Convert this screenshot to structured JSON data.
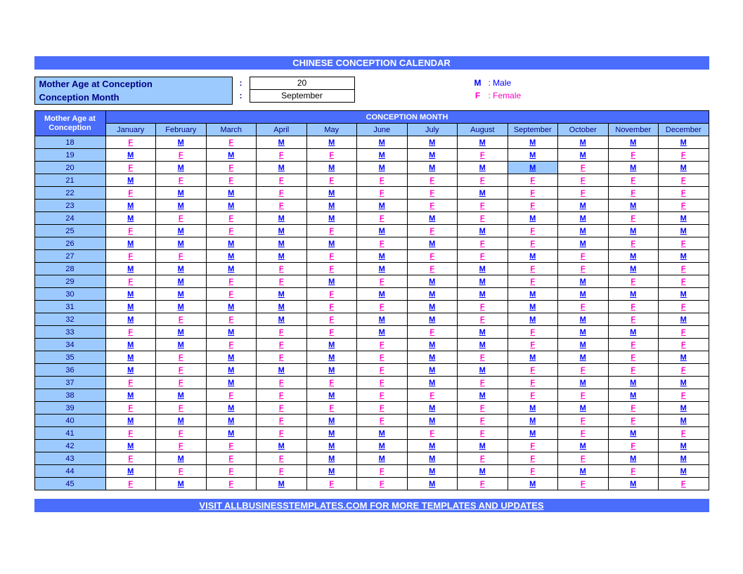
{
  "title": "CHINESE CONCEPTION CALENDAR",
  "inputs": {
    "age_label": "Mother Age at Conception",
    "age_value": "20",
    "month_label": "Conception Month",
    "month_value": "September",
    "colon": ":"
  },
  "legend": {
    "male_key": "M",
    "male_label": ": Male",
    "female_key": "F",
    "female_label": ": Female"
  },
  "table": {
    "corner_label": "Mother Age at Conception",
    "conception_month_title": "CONCEPTION MONTH",
    "months": [
      "January",
      "February",
      "March",
      "April",
      "May",
      "June",
      "July",
      "August",
      "September",
      "October",
      "November",
      "December"
    ],
    "ages": [
      18,
      19,
      20,
      21,
      22,
      23,
      24,
      25,
      26,
      27,
      28,
      29,
      30,
      31,
      32,
      33,
      34,
      35,
      36,
      37,
      38,
      39,
      40,
      41,
      42,
      43,
      44,
      45
    ],
    "highlight": {
      "age": 20,
      "month_index": 8
    }
  },
  "chart_data": {
    "type": "table",
    "title": "Chinese Conception Calendar — predicted gender by mother's age at conception vs conception month",
    "xlabel": "Conception Month",
    "ylabel": "Mother Age at Conception",
    "categories": [
      "January",
      "February",
      "March",
      "April",
      "May",
      "June",
      "July",
      "August",
      "September",
      "October",
      "November",
      "December"
    ],
    "rows": [
      {
        "age": 18,
        "values": [
          "F",
          "M",
          "F",
          "M",
          "M",
          "M",
          "M",
          "M",
          "M",
          "M",
          "M",
          "M"
        ]
      },
      {
        "age": 19,
        "values": [
          "M",
          "F",
          "M",
          "F",
          "F",
          "M",
          "M",
          "F",
          "M",
          "M",
          "F",
          "F"
        ]
      },
      {
        "age": 20,
        "values": [
          "F",
          "M",
          "F",
          "M",
          "M",
          "M",
          "M",
          "M",
          "M",
          "F",
          "M",
          "M"
        ]
      },
      {
        "age": 21,
        "values": [
          "M",
          "F",
          "F",
          "F",
          "F",
          "F",
          "F",
          "F",
          "F",
          "F",
          "F",
          "F"
        ]
      },
      {
        "age": 22,
        "values": [
          "F",
          "M",
          "M",
          "F",
          "M",
          "F",
          "F",
          "M",
          "F",
          "F",
          "F",
          "F"
        ]
      },
      {
        "age": 23,
        "values": [
          "M",
          "M",
          "M",
          "F",
          "M",
          "M",
          "F",
          "F",
          "F",
          "M",
          "M",
          "F"
        ]
      },
      {
        "age": 24,
        "values": [
          "M",
          "F",
          "F",
          "M",
          "M",
          "F",
          "M",
          "F",
          "M",
          "M",
          "F",
          "M"
        ]
      },
      {
        "age": 25,
        "values": [
          "F",
          "M",
          "F",
          "M",
          "F",
          "M",
          "F",
          "M",
          "F",
          "M",
          "M",
          "M"
        ]
      },
      {
        "age": 26,
        "values": [
          "M",
          "M",
          "M",
          "M",
          "M",
          "F",
          "M",
          "F",
          "F",
          "M",
          "F",
          "F"
        ]
      },
      {
        "age": 27,
        "values": [
          "F",
          "F",
          "M",
          "M",
          "F",
          "M",
          "F",
          "F",
          "M",
          "F",
          "M",
          "M"
        ]
      },
      {
        "age": 28,
        "values": [
          "M",
          "M",
          "M",
          "F",
          "F",
          "M",
          "F",
          "M",
          "F",
          "F",
          "M",
          "F"
        ]
      },
      {
        "age": 29,
        "values": [
          "F",
          "M",
          "F",
          "F",
          "M",
          "F",
          "M",
          "M",
          "F",
          "M",
          "F",
          "F"
        ]
      },
      {
        "age": 30,
        "values": [
          "M",
          "M",
          "F",
          "M",
          "F",
          "M",
          "M",
          "M",
          "M",
          "M",
          "M",
          "M"
        ]
      },
      {
        "age": 31,
        "values": [
          "M",
          "M",
          "M",
          "M",
          "F",
          "F",
          "M",
          "F",
          "M",
          "F",
          "F",
          "F"
        ]
      },
      {
        "age": 32,
        "values": [
          "M",
          "F",
          "F",
          "M",
          "F",
          "M",
          "M",
          "F",
          "M",
          "M",
          "F",
          "M"
        ]
      },
      {
        "age": 33,
        "values": [
          "F",
          "M",
          "M",
          "F",
          "F",
          "M",
          "F",
          "M",
          "F",
          "M",
          "M",
          "F"
        ]
      },
      {
        "age": 34,
        "values": [
          "M",
          "M",
          "F",
          "F",
          "M",
          "F",
          "M",
          "M",
          "F",
          "M",
          "F",
          "F"
        ]
      },
      {
        "age": 35,
        "values": [
          "M",
          "F",
          "M",
          "F",
          "M",
          "F",
          "M",
          "F",
          "M",
          "M",
          "F",
          "M"
        ]
      },
      {
        "age": 36,
        "values": [
          "M",
          "F",
          "M",
          "M",
          "M",
          "F",
          "M",
          "M",
          "F",
          "F",
          "F",
          "F"
        ]
      },
      {
        "age": 37,
        "values": [
          "F",
          "F",
          "M",
          "F",
          "F",
          "F",
          "M",
          "F",
          "F",
          "M",
          "M",
          "M"
        ]
      },
      {
        "age": 38,
        "values": [
          "M",
          "M",
          "F",
          "F",
          "M",
          "F",
          "F",
          "M",
          "F",
          "F",
          "M",
          "F"
        ]
      },
      {
        "age": 39,
        "values": [
          "F",
          "F",
          "M",
          "F",
          "F",
          "F",
          "M",
          "F",
          "M",
          "M",
          "F",
          "M"
        ]
      },
      {
        "age": 40,
        "values": [
          "M",
          "M",
          "M",
          "F",
          "M",
          "F",
          "M",
          "F",
          "M",
          "F",
          "F",
          "M"
        ]
      },
      {
        "age": 41,
        "values": [
          "F",
          "F",
          "M",
          "F",
          "M",
          "M",
          "F",
          "F",
          "M",
          "F",
          "M",
          "F"
        ]
      },
      {
        "age": 42,
        "values": [
          "M",
          "F",
          "F",
          "M",
          "M",
          "M",
          "M",
          "M",
          "F",
          "M",
          "F",
          "M"
        ]
      },
      {
        "age": 43,
        "values": [
          "F",
          "M",
          "F",
          "F",
          "M",
          "M",
          "M",
          "F",
          "F",
          "F",
          "M",
          "M"
        ]
      },
      {
        "age": 44,
        "values": [
          "M",
          "F",
          "F",
          "F",
          "M",
          "F",
          "M",
          "M",
          "F",
          "M",
          "F",
          "M"
        ]
      },
      {
        "age": 45,
        "values": [
          "F",
          "M",
          "F",
          "M",
          "F",
          "F",
          "M",
          "F",
          "M",
          "F",
          "M",
          "F"
        ]
      }
    ]
  },
  "footer": "VISIT ALLBUSINESSTEMPLATES.COM FOR MORE TEMPLATES AND UPDATES"
}
